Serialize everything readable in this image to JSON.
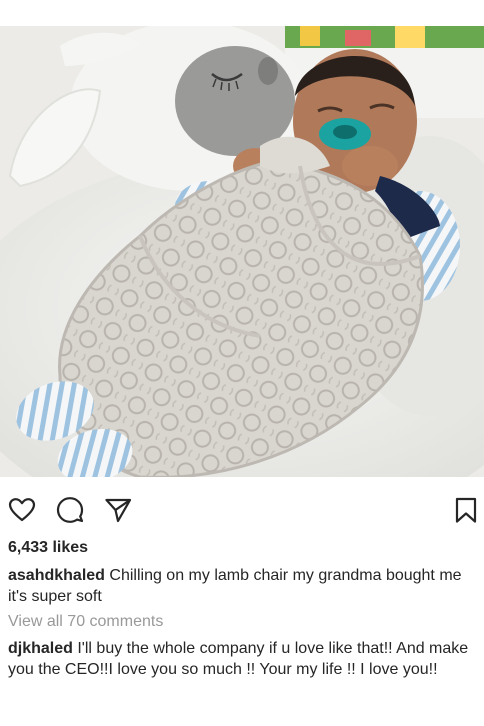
{
  "post": {
    "photo_alt": "",
    "icons": {
      "like": "heart-icon",
      "comment": "comment-icon",
      "share": "paper-plane-icon",
      "save": "bookmark-icon"
    },
    "likes": "6,433 likes",
    "caption": {
      "username": "asahdkhaled",
      "text": "Chilling on my lamb chair my grandma bought me it's super soft"
    },
    "view_all_comments": "View all 70 comments",
    "comments": [
      {
        "username": "djkhaled",
        "text": "I'll buy the whole company if u love like that!! And make you the CEO!!I love you so much !! Your my life !! I love you!!"
      }
    ]
  },
  "colors": {
    "text": "#262626",
    "muted": "#999999",
    "background": "#ffffff"
  }
}
